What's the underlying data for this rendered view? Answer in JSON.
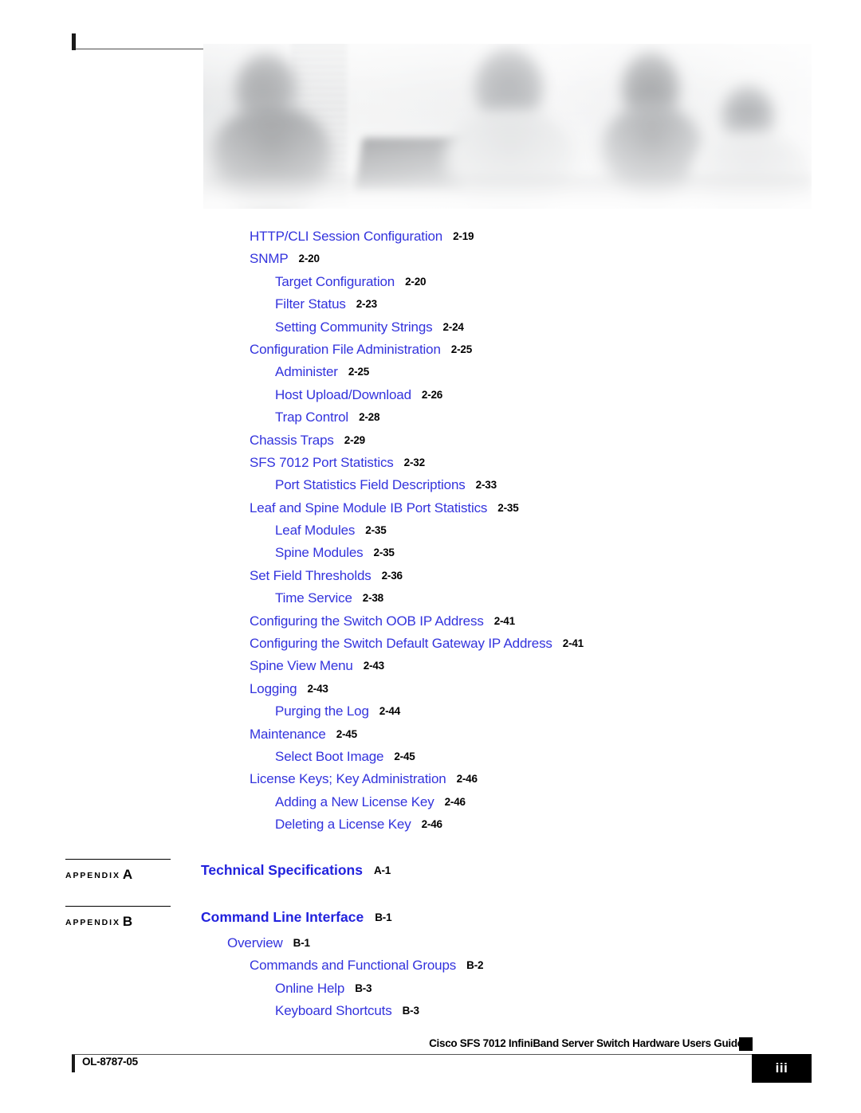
{
  "document": {
    "footer_title": "Cisco SFS 7012 InfiniBand Server Switch Hardware Users Guide",
    "doc_number": "OL-8787-05",
    "page_number": "iii"
  },
  "colors": {
    "link_blue": "#3333dd",
    "heading_blue": "#2222dd",
    "page_number_black": "#000000"
  },
  "toc": {
    "entries": [
      {
        "title": "HTTP/CLI Session Configuration",
        "page": "2-19",
        "level": 1
      },
      {
        "title": "SNMP",
        "page": "2-20",
        "level": 1
      },
      {
        "title": "Target Configuration",
        "page": "2-20",
        "level": 2
      },
      {
        "title": "Filter Status",
        "page": "2-23",
        "level": 2
      },
      {
        "title": "Setting Community Strings",
        "page": "2-24",
        "level": 2
      },
      {
        "title": "Configuration File Administration",
        "page": "2-25",
        "level": 1
      },
      {
        "title": "Administer",
        "page": "2-25",
        "level": 2
      },
      {
        "title": "Host Upload/Download",
        "page": "2-26",
        "level": 2
      },
      {
        "title": "Trap Control",
        "page": "2-28",
        "level": 2
      },
      {
        "title": "Chassis Traps",
        "page": "2-29",
        "level": 1
      },
      {
        "title": "SFS 7012 Port Statistics",
        "page": "2-32",
        "level": 1
      },
      {
        "title": "Port Statistics Field Descriptions",
        "page": "2-33",
        "level": 2
      },
      {
        "title": "Leaf and Spine Module IB Port Statistics",
        "page": "2-35",
        "level": 1
      },
      {
        "title": "Leaf Modules",
        "page": "2-35",
        "level": 2
      },
      {
        "title": "Spine Modules",
        "page": "2-35",
        "level": 2
      },
      {
        "title": "Set Field Thresholds",
        "page": "2-36",
        "level": 1
      },
      {
        "title": "Time Service",
        "page": "2-38",
        "level": 2
      },
      {
        "title": "Configuring the Switch OOB IP Address",
        "page": "2-41",
        "level": 1
      },
      {
        "title": "Configuring the Switch Default Gateway IP Address",
        "page": "2-41",
        "level": 1
      },
      {
        "title": "Spine View Menu",
        "page": "2-43",
        "level": 1
      },
      {
        "title": "Logging",
        "page": "2-43",
        "level": 1
      },
      {
        "title": "Purging the Log",
        "page": "2-44",
        "level": 2
      },
      {
        "title": "Maintenance",
        "page": "2-45",
        "level": 1
      },
      {
        "title": "Select Boot Image",
        "page": "2-45",
        "level": 2
      },
      {
        "title": "License Keys; Key Administration",
        "page": "2-46",
        "level": 1
      },
      {
        "title": "Adding a New License Key",
        "page": "2-46",
        "level": 2
      },
      {
        "title": "Deleting a License Key",
        "page": "2-46",
        "level": 2
      }
    ]
  },
  "appendices": [
    {
      "tag_word": "APPENDIX",
      "tag_letter": "A",
      "title": "Technical Specifications",
      "page": "A-1",
      "children": []
    },
    {
      "tag_word": "APPENDIX",
      "tag_letter": "B",
      "title": "Command Line Interface",
      "page": "B-1",
      "children": [
        {
          "title": "Overview",
          "page": "B-1",
          "level": 0
        },
        {
          "title": "Commands and Functional Groups",
          "page": "B-2",
          "level": 1
        },
        {
          "title": "Online Help",
          "page": "B-3",
          "level": 2
        },
        {
          "title": "Keyboard Shortcuts",
          "page": "B-3",
          "level": 2
        }
      ]
    }
  ]
}
